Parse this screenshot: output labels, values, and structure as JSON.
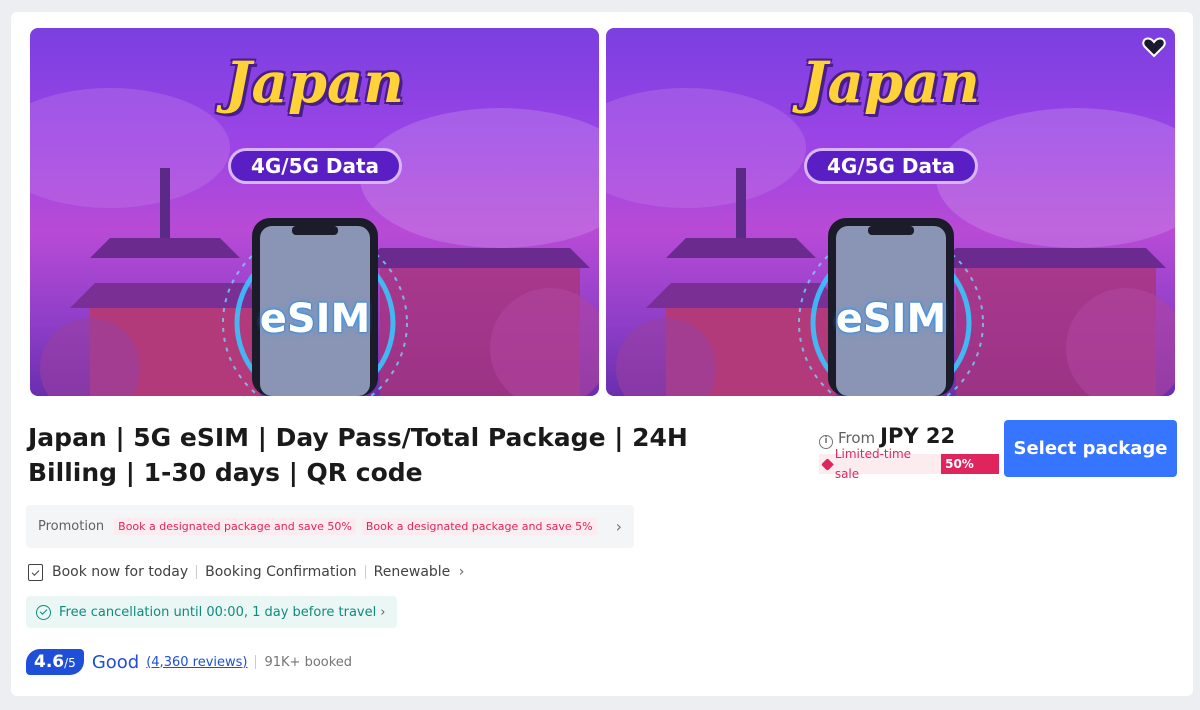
{
  "gallery": {
    "images": [
      {
        "title": "Japan",
        "pill": "4G/5G Data",
        "label": "eSIM"
      },
      {
        "title": "Japan",
        "pill": "4G/5G Data",
        "label": "eSIM"
      }
    ],
    "wishlist_icon": "heart-icon"
  },
  "product": {
    "title": "Japan | 5G eSIM | Day Pass/Total Package | 24H Billing | 1-30 days | QR code"
  },
  "price": {
    "info_icon": "info-icon",
    "from_label": "From",
    "amount": "JPY 22",
    "sale_label": "Limited-time sale",
    "discount_badge": "50% off"
  },
  "cta": {
    "label": "Select package"
  },
  "promotion": {
    "label": "Promotion",
    "chips": [
      "Book a designated package and save 50%",
      "Book a designated package and save 5%"
    ]
  },
  "features": {
    "items": [
      "Book now for today",
      "Booking Confirmation",
      "Renewable"
    ]
  },
  "cancellation": {
    "text": "Free cancellation until 00:00, 1 day before travel"
  },
  "rating": {
    "score": "4.6",
    "max": "/5",
    "word": "Good",
    "reviews": "(4,360 reviews)",
    "booked": "91K+ booked"
  },
  "colors": {
    "accent": "#3575ff",
    "rating": "#1f4fd8",
    "sale": "#e0245e",
    "cancel": "#0f8b7e"
  }
}
